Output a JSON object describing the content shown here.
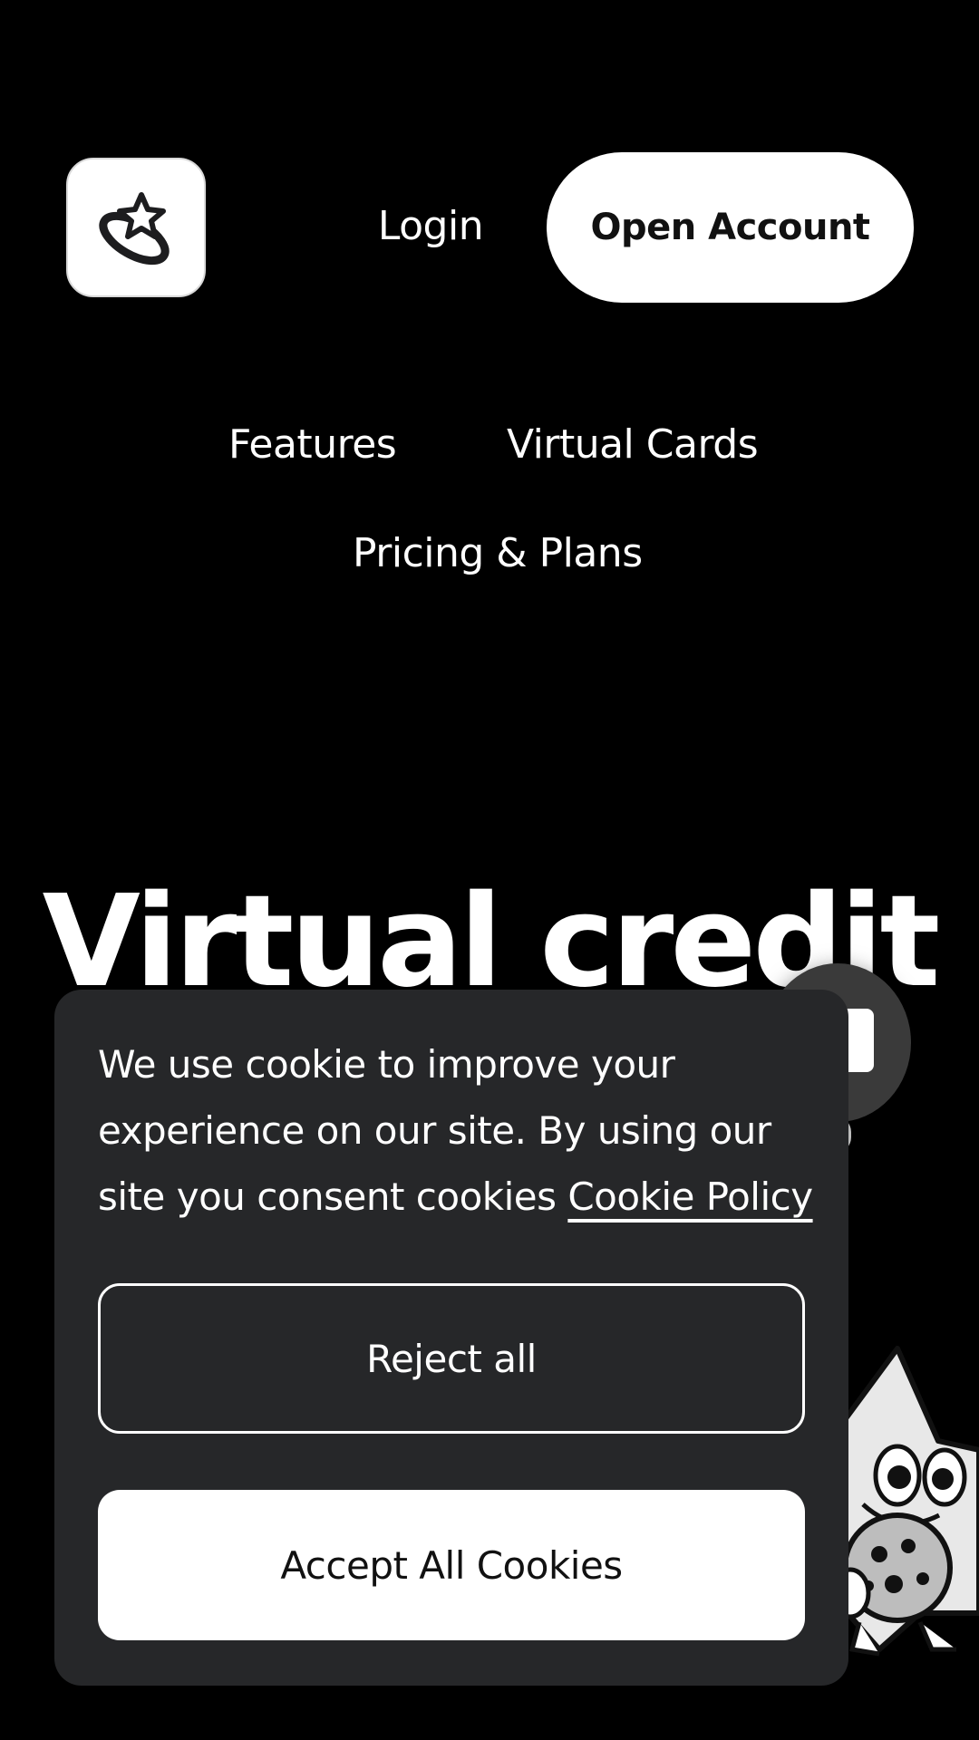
{
  "header": {
    "logo_icon": "star-orbit-icon",
    "login_label": "Login",
    "open_account_label": "Open Account"
  },
  "nav": {
    "items": [
      {
        "label": "Features"
      },
      {
        "label": "Virtual Cards"
      },
      {
        "label": "Pricing & Plans"
      }
    ]
  },
  "hero": {
    "title": "Virtual credit"
  },
  "cookie_banner": {
    "message": "We use cookie to improve your experience on our site. By using our site you consent cookies ",
    "policy_link": "Cookie Policy",
    "reject_label": "Reject all",
    "accept_label": "Accept All Cookies"
  },
  "colors": {
    "background": "#000000",
    "panel": "#262729",
    "button_light": "#ffffff"
  }
}
